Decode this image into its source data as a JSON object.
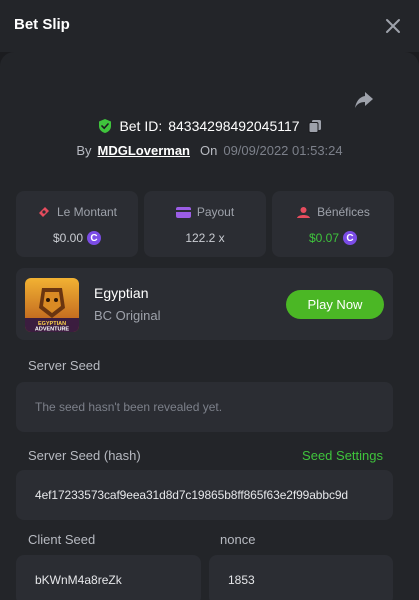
{
  "header": {
    "title": "Bet Slip"
  },
  "bet": {
    "id_label": "Bet ID:",
    "id": "84334298492045117",
    "by_label": "By",
    "user": "MDGLoverman",
    "on_label": "On",
    "date": "09/09/2022 01:53:24"
  },
  "stats": [
    {
      "title": "Le Montant",
      "value": "$0.00",
      "coin": true
    },
    {
      "title": "Payout",
      "value": "122.2 x",
      "coin": false
    },
    {
      "title": "Bénéfices",
      "value": "$0.07",
      "coin": true
    }
  ],
  "game": {
    "name": "Egyptian",
    "subtitle": "BC Original",
    "thumb_text": "EGYPTIAN\nADVENTURE",
    "play_label": "Play Now"
  },
  "seeds": {
    "server_label": "Server Seed",
    "server_value": "The seed hasn't been revealed yet.",
    "hash_label": "Server Seed (hash)",
    "settings_link": "Seed Settings",
    "hash_value": "4ef17233573caf9eea31d8d7c19865b8ff865f63e2f99abbc9d",
    "client_label": "Client Seed",
    "client_value": "bKWnM4a8reZk",
    "nonce_label": "nonce",
    "nonce_value": "1853"
  },
  "colors": {
    "accent_green": "#4bb725",
    "coin_purple": "#7b4ce6"
  }
}
